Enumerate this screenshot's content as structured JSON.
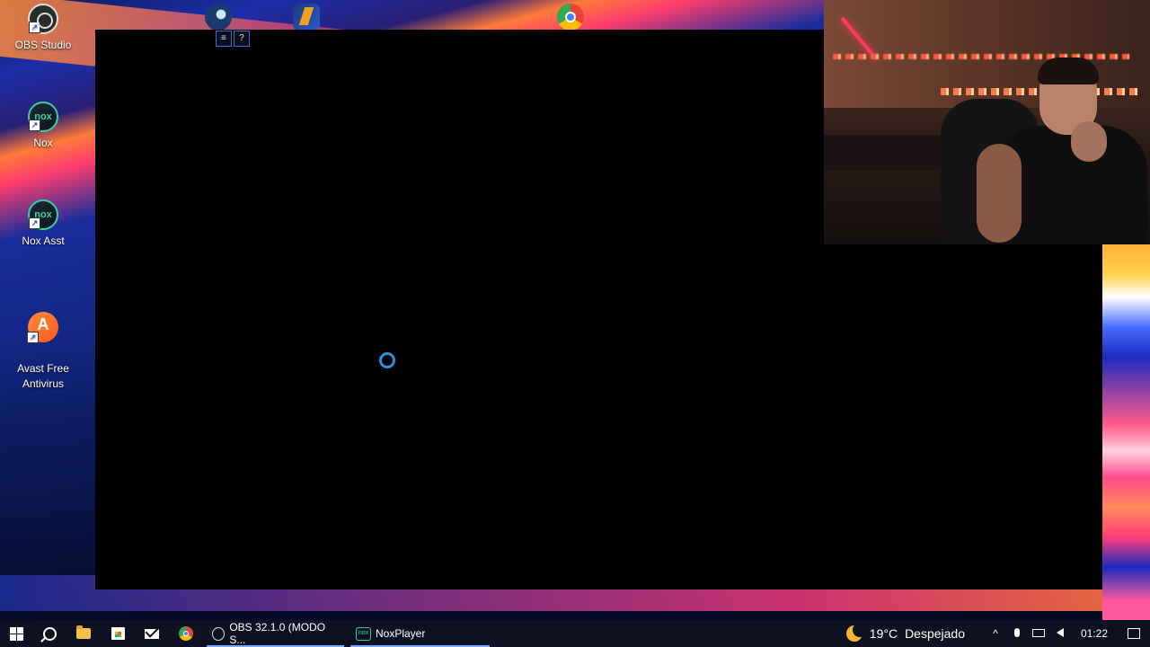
{
  "desktop": {
    "icons": [
      {
        "label": "OBS Studio",
        "icon": "obs-icon"
      },
      {
        "label": "Nox",
        "icon": "nox-icon"
      },
      {
        "label": "Nox Asst",
        "icon": "nox-asst-icon"
      },
      {
        "label": "Avast Free\nAntivirus",
        "icon": "avast-icon"
      }
    ],
    "nox_icon_text": "nox"
  },
  "nox_window": {
    "menu_glyph": "≡",
    "help_glyph": "?",
    "state": "loading"
  },
  "taskbar": {
    "apps": [
      {
        "label": "OBS 32.1.0 (MODO S...",
        "icon": "obs-icon",
        "active": true
      },
      {
        "label": "NoxPlayer",
        "icon": "nox-icon",
        "active": true
      }
    ],
    "weather": {
      "temp": "19°C",
      "condition": "Despejado",
      "icon": "moon-icon"
    },
    "tray_chevron": "^",
    "clock": "01:22"
  }
}
